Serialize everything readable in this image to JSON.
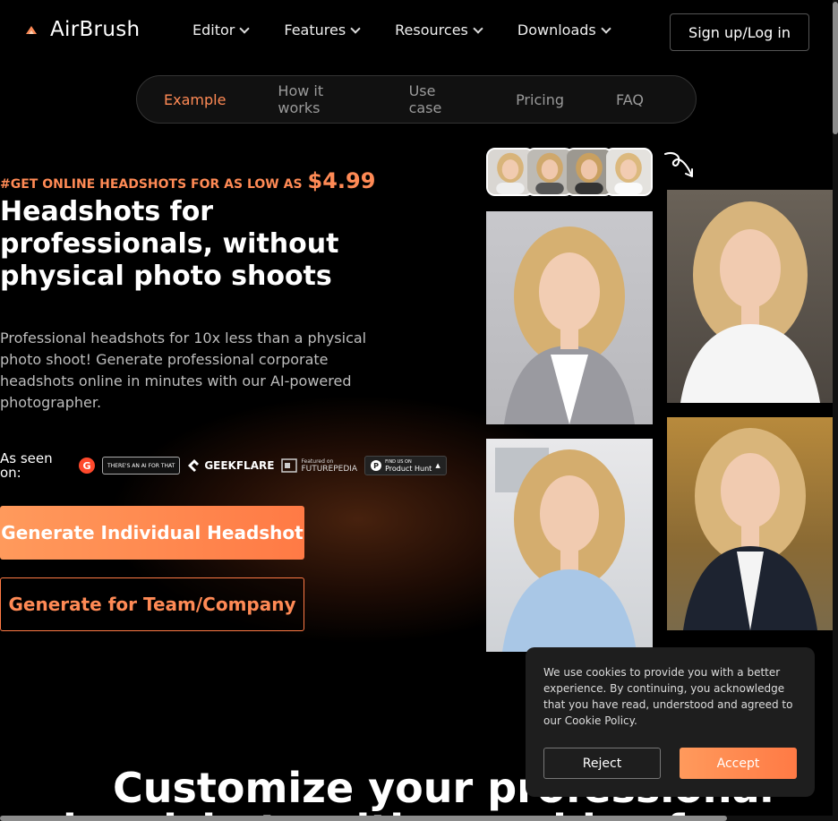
{
  "header": {
    "brand": "AirBrush",
    "nav": [
      "Editor",
      "Features",
      "Resources",
      "Downloads"
    ],
    "signup_label": "Sign up/Log in"
  },
  "subnav": {
    "items": [
      "Example",
      "How it works",
      "Use case",
      "Pricing",
      "FAQ"
    ],
    "active": "Example"
  },
  "hero": {
    "promo_text": "#GET ONLINE HEADSHOTS FOR AS LOW AS",
    "promo_price": "$4.99",
    "title": "Headshots for professionals, without physical photo shoots",
    "description": "Professional headshots for 10x less than a physical photo shoot! Generate professional corporate headshots online in minutes with our AI-powered photographer.",
    "seen_on_label": "As seen on:",
    "seen_on": {
      "g2": "G",
      "theres_an_ai": "THERE'S AN AI FOR THAT",
      "geekflare": "GEEKFLARE",
      "futurepedia_small": "Featured on",
      "futurepedia": "FUTUREPEDIA",
      "producthunt_small": "FIND US ON",
      "producthunt": "Product Hunt"
    },
    "primary_cta": "Generate Individual Headshot",
    "secondary_cta": "Generate for Team/Company"
  },
  "cookie": {
    "text": "We use cookies to provide you with a better experience. By continuing, you acknowledge that you have read, understood and agreed to our Cookie Policy.",
    "reject_label": "Reject",
    "accept_label": "Accept"
  },
  "section": {
    "title_line1": "Customize your professional",
    "title_line2": "headshots with our video fo"
  },
  "colors": {
    "accent": "#ff8a55",
    "background": "#000000",
    "cookie_bg": "#1e1e1e"
  }
}
